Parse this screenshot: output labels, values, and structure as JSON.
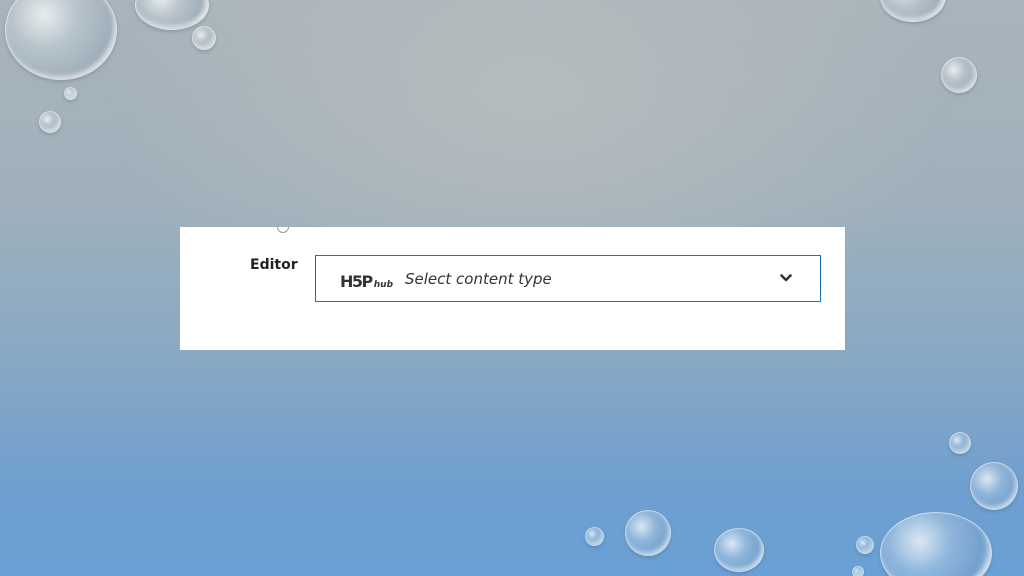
{
  "form": {
    "field_label": "Editor",
    "hub_logo_main": "H5P",
    "hub_logo_sub": "hub",
    "select_placeholder": "Select content type"
  },
  "icons": {
    "info": "info-icon",
    "dropdown": "chevron-down-icon",
    "logo": "h5p-hub-logo"
  },
  "colors": {
    "select_border": "#1a73b8",
    "panel_background": "#ffffff"
  }
}
